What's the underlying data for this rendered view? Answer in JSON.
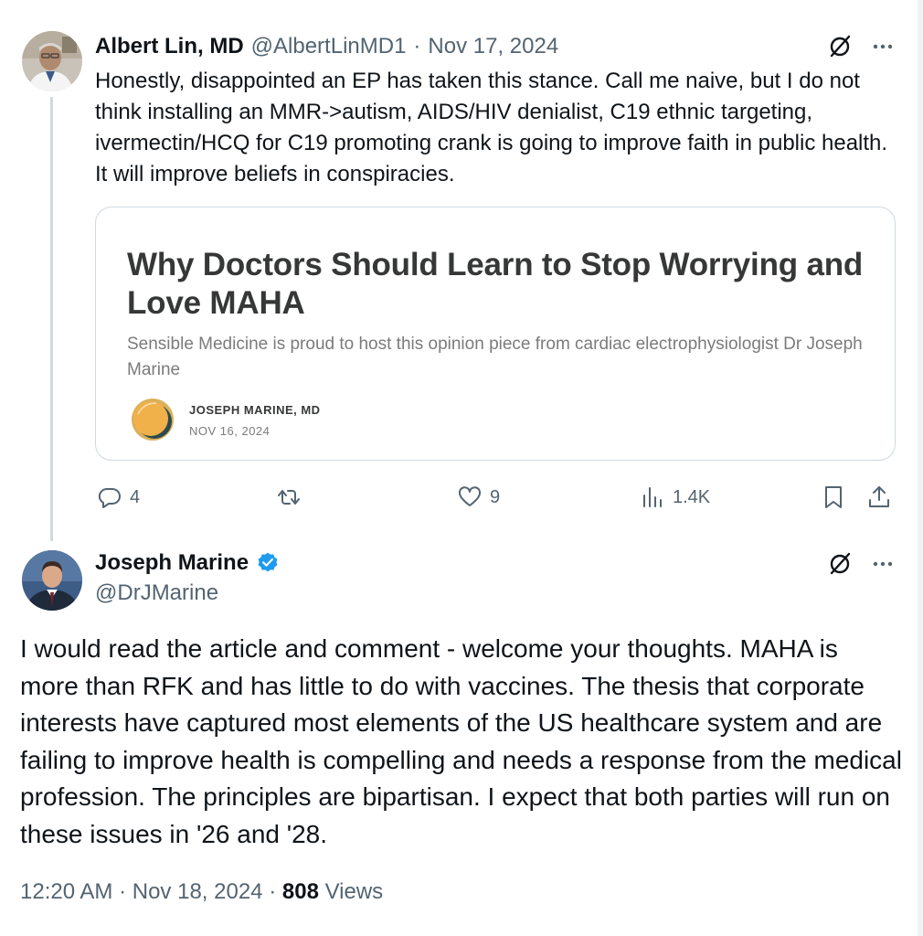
{
  "parent_tweet": {
    "author_name": "Albert Lin, MD",
    "handle": "@AlbertLinMD1",
    "separator": "·",
    "date": "Nov 17, 2024",
    "text": "Honestly, disappointed an EP has taken this stance. Call me naive, but I do not think installing an MMR->autism, AIDS/HIV denialist, C19 ethnic targeting, ivermectin/HCQ for C19 promoting crank is going to improve faith in public health. It will improve beliefs in conspiracies.",
    "link_card": {
      "title": "Why Doctors Should Learn to Stop Worrying and Love MAHA",
      "description": "Sensible Medicine is proud to host this opinion piece from cardiac electrophysiologist Dr Joseph Marine",
      "author": "JOSEPH MARINE, MD",
      "date": "NOV 16, 2024"
    },
    "actions": {
      "replies": "4",
      "retweets": "",
      "likes": "9",
      "views": "1.4K"
    }
  },
  "main_tweet": {
    "author_name": "Joseph Marine",
    "handle": "@DrJMarine",
    "text": "I would read the article and comment - welcome your thoughts. MAHA is more than RFK and has little to do with vaccines. The thesis that corporate interests have captured most elements of the US healthcare system and are failing to improve health is compelling and needs a response from the medical profession. The principles are bipartisan. I expect that both parties will run on these issues in '26 and '28.",
    "time": "12:20 AM",
    "date": "Nov 18, 2024",
    "separator": "·",
    "views_count": "808",
    "views_label": "Views"
  },
  "icons": {
    "reply": "reply-icon",
    "retweet": "retweet-icon",
    "like": "heart-icon",
    "views": "analytics-icon",
    "bookmark": "bookmark-icon",
    "share": "share-icon",
    "grok": "grok-icon",
    "more": "more-icon",
    "verified": "verified-badge-icon"
  },
  "colors": {
    "text_primary": "#0f1419",
    "text_secondary": "#536471",
    "border": "#cfd9de",
    "verified_blue": "#1d9bf0"
  }
}
